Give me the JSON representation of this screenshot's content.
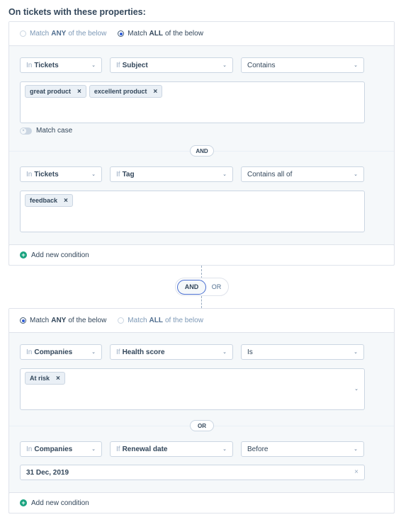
{
  "heading": "On tickets with these properties:",
  "groups": [
    {
      "match_options": [
        {
          "prefix": "Match",
          "keyword": "ANY",
          "suffix": "of the below",
          "selected": false
        },
        {
          "prefix": "Match",
          "keyword": "ALL",
          "suffix": "of the below",
          "selected": true
        }
      ],
      "conditions": [
        {
          "object": {
            "prefix": "In",
            "value": "Tickets"
          },
          "property": {
            "prefix": "If",
            "value": "Subject"
          },
          "operator": "Contains",
          "values": [
            "great product",
            "excellent product"
          ],
          "match_case": {
            "label": "Match case",
            "enabled": false
          }
        },
        {
          "object": {
            "prefix": "In",
            "value": "Tickets"
          },
          "property": {
            "prefix": "If",
            "value": "Tag"
          },
          "operator": "Contains all of",
          "values": [
            "feedback"
          ]
        }
      ],
      "joiner": "AND",
      "add_label": "Add new condition"
    },
    {
      "match_options": [
        {
          "prefix": "Match",
          "keyword": "ANY",
          "suffix": "of the below",
          "selected": true
        },
        {
          "prefix": "Match",
          "keyword": "ALL",
          "suffix": "of the below",
          "selected": false
        }
      ],
      "conditions": [
        {
          "object": {
            "prefix": "In",
            "value": "Companies"
          },
          "property": {
            "prefix": "If",
            "value": "Health score"
          },
          "operator": "Is",
          "values": [
            "At risk"
          ]
        },
        {
          "object": {
            "prefix": "In",
            "value": "Companies"
          },
          "property": {
            "prefix": "If",
            "value": "Renewal date"
          },
          "operator": "Before",
          "date_value": "31 Dec, 2019"
        }
      ],
      "joiner": "OR",
      "add_label": "Add new condition"
    }
  ],
  "group_switch": {
    "options": [
      "AND",
      "OR"
    ],
    "selected": "AND"
  },
  "icons": {
    "chevron": "⌄",
    "remove": "×",
    "plus": "+",
    "clear": "×"
  },
  "colors": {
    "accent_blue": "#2d5bd6",
    "add_green": "#19a37f",
    "border": "#cbd6e2",
    "text": "#33475b"
  }
}
